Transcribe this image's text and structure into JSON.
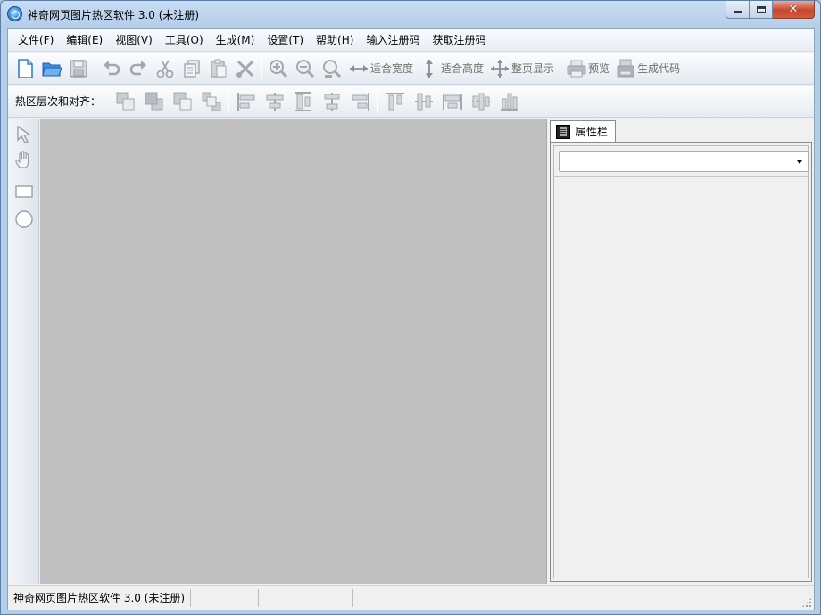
{
  "window": {
    "title": "神奇网页图片热区软件 3.0 (未注册)",
    "close_glyph": "✕"
  },
  "menubar": {
    "items": [
      "文件(F)",
      "编辑(E)",
      "视图(V)",
      "工具(O)",
      "生成(M)",
      "设置(T)",
      "帮助(H)",
      "输入注册码",
      "获取注册码"
    ]
  },
  "toolbar": {
    "fit_width": "适合宽度",
    "fit_height": "适合高度",
    "fit_page": "整页显示",
    "preview": "预览",
    "generate_code": "生成代码"
  },
  "align_toolbar": {
    "label": "热区层次和对齐："
  },
  "properties": {
    "tab_label": "属性栏",
    "selected_value": ""
  },
  "statusbar": {
    "cells": [
      "神奇网页图片热区软件 3.0 (未注册)",
      "",
      "",
      ""
    ]
  },
  "colors": {
    "canvas_bg": "#c0c0c0",
    "icon_gray": "#9aa0a8",
    "icon_blue": "#2f7fd6"
  }
}
